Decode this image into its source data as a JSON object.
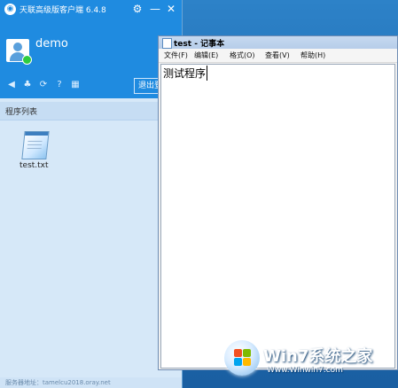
{
  "client": {
    "title": "天联高级版客户端 6.4.8",
    "username": "demo",
    "exit_label": "退出登录",
    "section_title": "程序列表",
    "programs": [
      {
        "label": "test.txt",
        "icon": "notepad-icon"
      }
    ],
    "footer": "服务器地址：tamelcu2018.oray.net"
  },
  "notepad": {
    "title": "test - 记事本",
    "menu": [
      "文件(F)",
      "编辑(E)",
      "格式(O)",
      "查看(V)",
      "帮助(H)"
    ],
    "content": "测试程序"
  },
  "watermark": {
    "brand": "Win7系统之家",
    "url": "Www.Winwin7.com"
  }
}
